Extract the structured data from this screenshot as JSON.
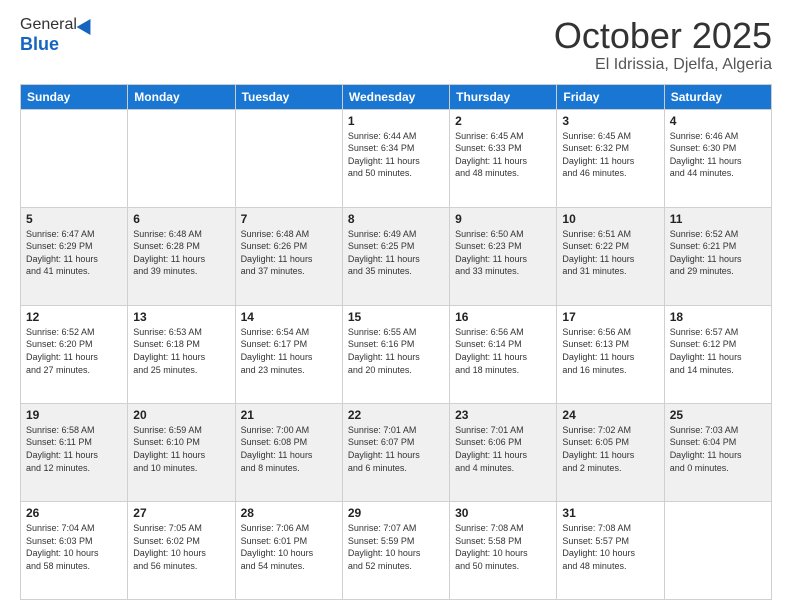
{
  "header": {
    "logo_general": "General",
    "logo_blue": "Blue",
    "title": "October 2025",
    "location": "El Idrissia, Djelfa, Algeria"
  },
  "weekdays": [
    "Sunday",
    "Monday",
    "Tuesday",
    "Wednesday",
    "Thursday",
    "Friday",
    "Saturday"
  ],
  "weeks": [
    {
      "shaded": false,
      "days": [
        {
          "num": "",
          "info": ""
        },
        {
          "num": "",
          "info": ""
        },
        {
          "num": "",
          "info": ""
        },
        {
          "num": "1",
          "info": "Sunrise: 6:44 AM\nSunset: 6:34 PM\nDaylight: 11 hours\nand 50 minutes."
        },
        {
          "num": "2",
          "info": "Sunrise: 6:45 AM\nSunset: 6:33 PM\nDaylight: 11 hours\nand 48 minutes."
        },
        {
          "num": "3",
          "info": "Sunrise: 6:45 AM\nSunset: 6:32 PM\nDaylight: 11 hours\nand 46 minutes."
        },
        {
          "num": "4",
          "info": "Sunrise: 6:46 AM\nSunset: 6:30 PM\nDaylight: 11 hours\nand 44 minutes."
        }
      ]
    },
    {
      "shaded": true,
      "days": [
        {
          "num": "5",
          "info": "Sunrise: 6:47 AM\nSunset: 6:29 PM\nDaylight: 11 hours\nand 41 minutes."
        },
        {
          "num": "6",
          "info": "Sunrise: 6:48 AM\nSunset: 6:28 PM\nDaylight: 11 hours\nand 39 minutes."
        },
        {
          "num": "7",
          "info": "Sunrise: 6:48 AM\nSunset: 6:26 PM\nDaylight: 11 hours\nand 37 minutes."
        },
        {
          "num": "8",
          "info": "Sunrise: 6:49 AM\nSunset: 6:25 PM\nDaylight: 11 hours\nand 35 minutes."
        },
        {
          "num": "9",
          "info": "Sunrise: 6:50 AM\nSunset: 6:23 PM\nDaylight: 11 hours\nand 33 minutes."
        },
        {
          "num": "10",
          "info": "Sunrise: 6:51 AM\nSunset: 6:22 PM\nDaylight: 11 hours\nand 31 minutes."
        },
        {
          "num": "11",
          "info": "Sunrise: 6:52 AM\nSunset: 6:21 PM\nDaylight: 11 hours\nand 29 minutes."
        }
      ]
    },
    {
      "shaded": false,
      "days": [
        {
          "num": "12",
          "info": "Sunrise: 6:52 AM\nSunset: 6:20 PM\nDaylight: 11 hours\nand 27 minutes."
        },
        {
          "num": "13",
          "info": "Sunrise: 6:53 AM\nSunset: 6:18 PM\nDaylight: 11 hours\nand 25 minutes."
        },
        {
          "num": "14",
          "info": "Sunrise: 6:54 AM\nSunset: 6:17 PM\nDaylight: 11 hours\nand 23 minutes."
        },
        {
          "num": "15",
          "info": "Sunrise: 6:55 AM\nSunset: 6:16 PM\nDaylight: 11 hours\nand 20 minutes."
        },
        {
          "num": "16",
          "info": "Sunrise: 6:56 AM\nSunset: 6:14 PM\nDaylight: 11 hours\nand 18 minutes."
        },
        {
          "num": "17",
          "info": "Sunrise: 6:56 AM\nSunset: 6:13 PM\nDaylight: 11 hours\nand 16 minutes."
        },
        {
          "num": "18",
          "info": "Sunrise: 6:57 AM\nSunset: 6:12 PM\nDaylight: 11 hours\nand 14 minutes."
        }
      ]
    },
    {
      "shaded": true,
      "days": [
        {
          "num": "19",
          "info": "Sunrise: 6:58 AM\nSunset: 6:11 PM\nDaylight: 11 hours\nand 12 minutes."
        },
        {
          "num": "20",
          "info": "Sunrise: 6:59 AM\nSunset: 6:10 PM\nDaylight: 11 hours\nand 10 minutes."
        },
        {
          "num": "21",
          "info": "Sunrise: 7:00 AM\nSunset: 6:08 PM\nDaylight: 11 hours\nand 8 minutes."
        },
        {
          "num": "22",
          "info": "Sunrise: 7:01 AM\nSunset: 6:07 PM\nDaylight: 11 hours\nand 6 minutes."
        },
        {
          "num": "23",
          "info": "Sunrise: 7:01 AM\nSunset: 6:06 PM\nDaylight: 11 hours\nand 4 minutes."
        },
        {
          "num": "24",
          "info": "Sunrise: 7:02 AM\nSunset: 6:05 PM\nDaylight: 11 hours\nand 2 minutes."
        },
        {
          "num": "25",
          "info": "Sunrise: 7:03 AM\nSunset: 6:04 PM\nDaylight: 11 hours\nand 0 minutes."
        }
      ]
    },
    {
      "shaded": false,
      "days": [
        {
          "num": "26",
          "info": "Sunrise: 7:04 AM\nSunset: 6:03 PM\nDaylight: 10 hours\nand 58 minutes."
        },
        {
          "num": "27",
          "info": "Sunrise: 7:05 AM\nSunset: 6:02 PM\nDaylight: 10 hours\nand 56 minutes."
        },
        {
          "num": "28",
          "info": "Sunrise: 7:06 AM\nSunset: 6:01 PM\nDaylight: 10 hours\nand 54 minutes."
        },
        {
          "num": "29",
          "info": "Sunrise: 7:07 AM\nSunset: 5:59 PM\nDaylight: 10 hours\nand 52 minutes."
        },
        {
          "num": "30",
          "info": "Sunrise: 7:08 AM\nSunset: 5:58 PM\nDaylight: 10 hours\nand 50 minutes."
        },
        {
          "num": "31",
          "info": "Sunrise: 7:08 AM\nSunset: 5:57 PM\nDaylight: 10 hours\nand 48 minutes."
        },
        {
          "num": "",
          "info": ""
        }
      ]
    }
  ]
}
